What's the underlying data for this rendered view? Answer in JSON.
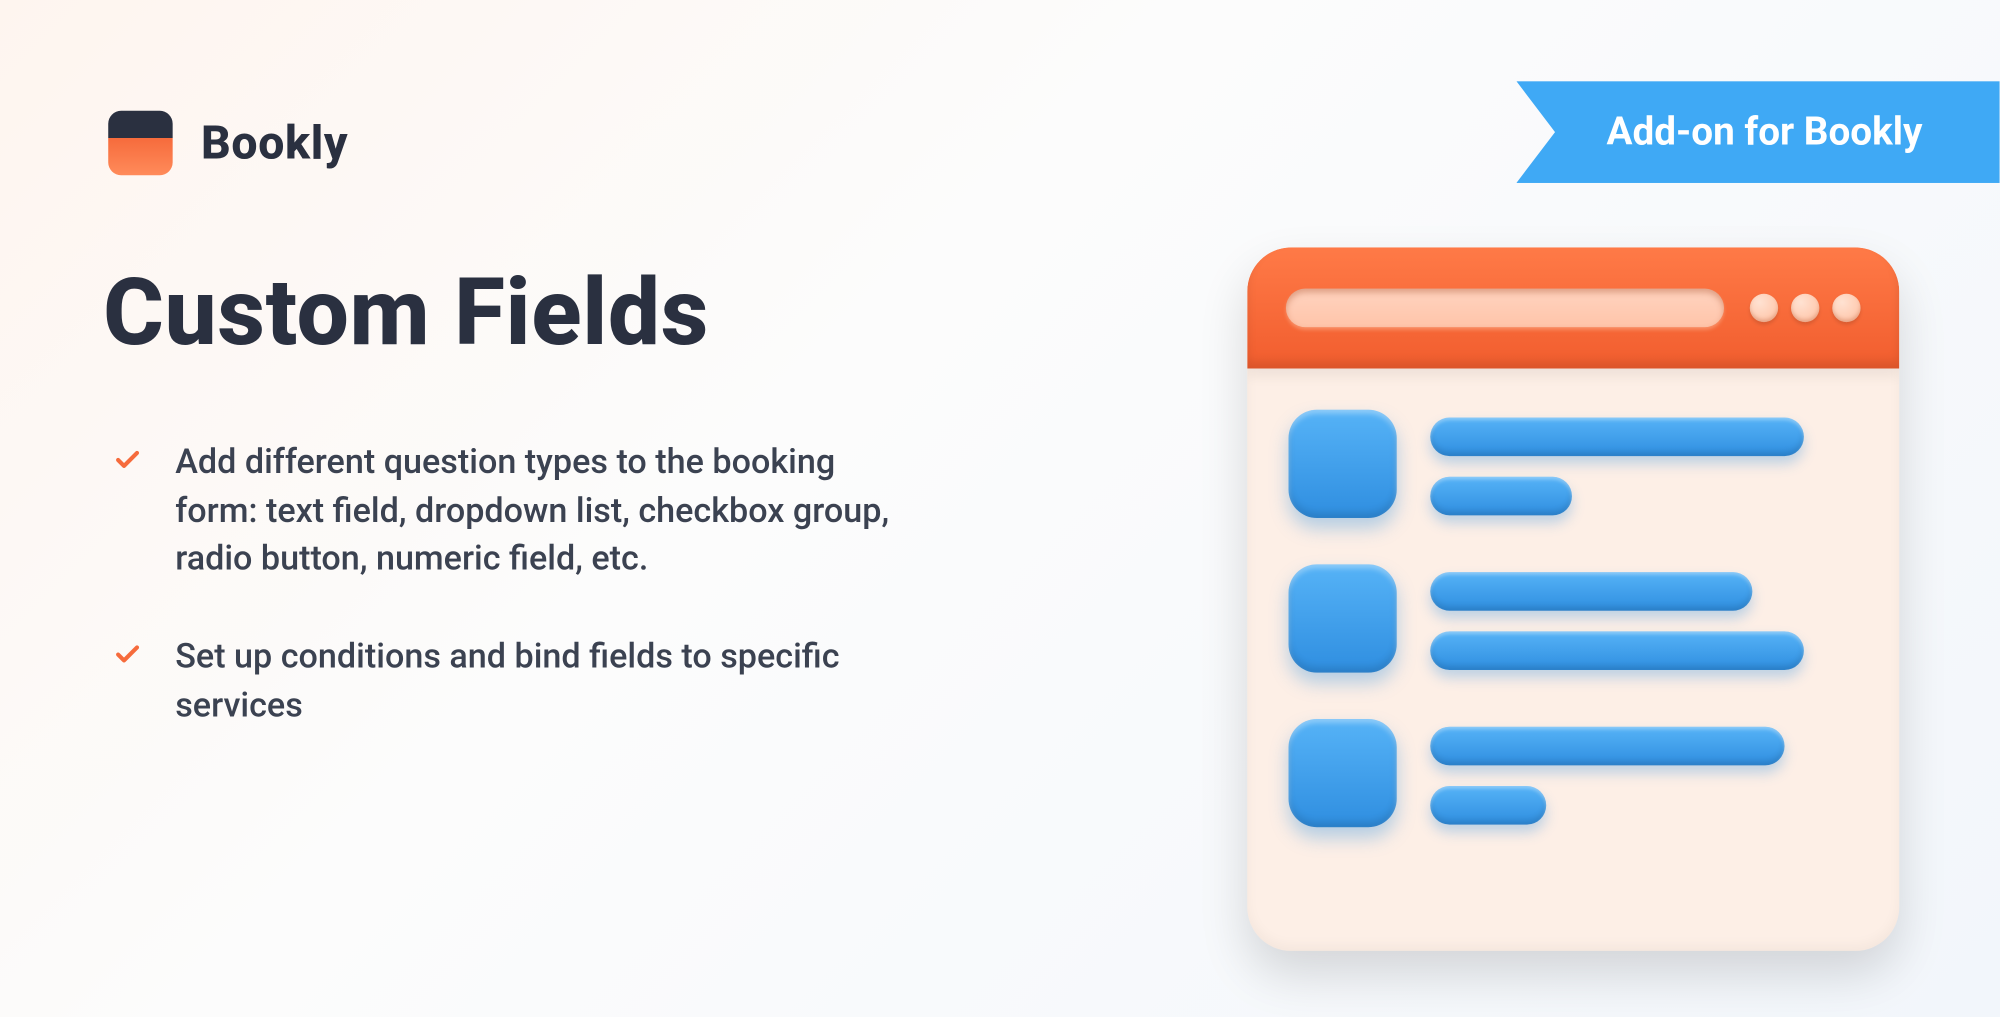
{
  "brand": {
    "name": "Bookly"
  },
  "ribbon": {
    "label": "Add-on for Bookly"
  },
  "title": "Custom Fields",
  "bullets": [
    "Add different question types to the booking form: text field, dropdown list, checkbox group, radio button, numeric field, etc.",
    "Set up conditions and bind fields to specific services"
  ],
  "colors": {
    "accent": "#f66b3c",
    "ribbon": "#3fa9f5",
    "text": "#2a3040"
  }
}
